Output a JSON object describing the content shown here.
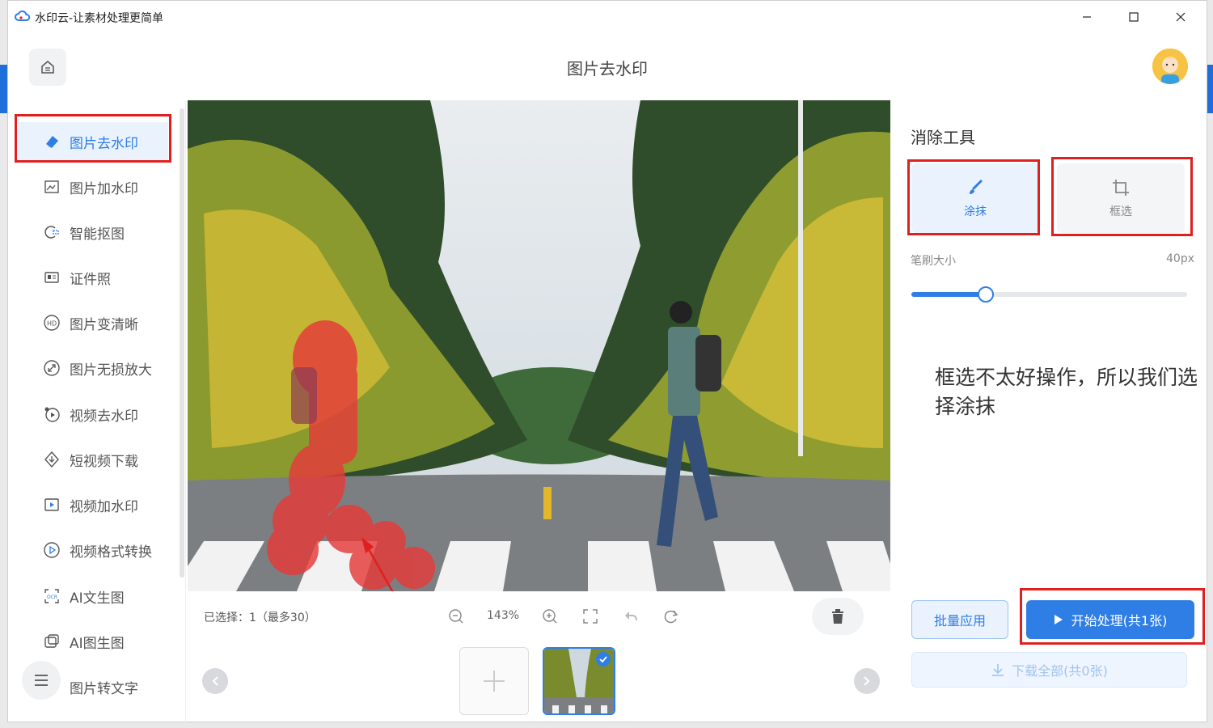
{
  "window": {
    "title": "水印云-让素材处理更简单"
  },
  "header": {
    "page_title": "图片去水印"
  },
  "sidebar": {
    "items": [
      {
        "label": "图片去水印",
        "icon": "eraser-icon",
        "active": true
      },
      {
        "label": "图片加水印",
        "icon": "image-edit-icon"
      },
      {
        "label": "智能抠图",
        "icon": "cutout-icon"
      },
      {
        "label": "证件照",
        "icon": "id-card-icon"
      },
      {
        "label": "图片变清晰",
        "icon": "hd-icon"
      },
      {
        "label": "图片无损放大",
        "icon": "expand-icon"
      },
      {
        "label": "视频去水印",
        "icon": "video-eraser-icon"
      },
      {
        "label": "短视频下载",
        "icon": "download-shield-icon"
      },
      {
        "label": "视频加水印",
        "icon": "video-add-icon"
      },
      {
        "label": "视频格式转换",
        "icon": "play-circle-icon"
      },
      {
        "label": "AI文生图",
        "icon": "ocr-scan-icon"
      },
      {
        "label": "AI图生图",
        "icon": "image-stack-icon"
      },
      {
        "label": "图片转文字",
        "icon": "text-icon"
      }
    ]
  },
  "toolbar": {
    "selected_text": "已选择：1（最多30）",
    "zoom_level": "143%"
  },
  "panel": {
    "title": "消除工具",
    "tool_smear": "涂抹",
    "tool_box": "框选",
    "brush_label": "笔刷大小",
    "brush_value": "40px",
    "brush_level": 0.27,
    "note": "框选不太好操作，所以我们选择涂抹",
    "batch_apply": "批量应用",
    "start_process": "开始处理(共1张)",
    "download_all": "下载全部(共0张)"
  },
  "colors": {
    "accent": "#2f7ee6",
    "highlight": "#e02020"
  }
}
